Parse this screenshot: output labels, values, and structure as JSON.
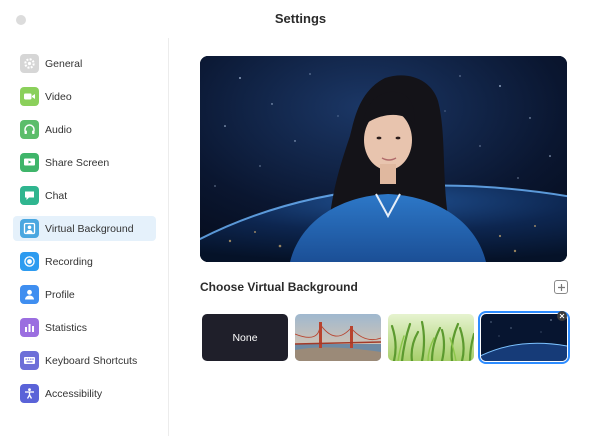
{
  "window": {
    "title": "Settings"
  },
  "sidebar": {
    "items": [
      {
        "label": "General",
        "icon": "gear-icon",
        "color": "#d6d6d6",
        "selected": false
      },
      {
        "label": "Video",
        "icon": "video-camera-icon",
        "color": "#8bd05b",
        "selected": false
      },
      {
        "label": "Audio",
        "icon": "headphones-icon",
        "color": "#5cbd6a",
        "selected": false
      },
      {
        "label": "Share Screen",
        "icon": "share-screen-icon",
        "color": "#3fb56a",
        "selected": false
      },
      {
        "label": "Chat",
        "icon": "chat-bubble-icon",
        "color": "#2fb58f",
        "selected": false
      },
      {
        "label": "Virtual Background",
        "icon": "portrait-icon",
        "color": "#4aa7e0",
        "selected": true
      },
      {
        "label": "Recording",
        "icon": "record-icon",
        "color": "#2d9bf0",
        "selected": false
      },
      {
        "label": "Profile",
        "icon": "person-icon",
        "color": "#3f8ef0",
        "selected": false
      },
      {
        "label": "Statistics",
        "icon": "bar-chart-icon",
        "color": "#9b6ee0",
        "selected": false
      },
      {
        "label": "Keyboard Shortcuts",
        "icon": "keyboard-icon",
        "color": "#6d6fd8",
        "selected": false
      },
      {
        "label": "Accessibility",
        "icon": "accessibility-icon",
        "color": "#5a63d8",
        "selected": false
      }
    ]
  },
  "main": {
    "section_title": "Choose Virtual Background",
    "add_icon": "plus-icon",
    "backgrounds": [
      {
        "label": "None",
        "kind": "none",
        "selected": false
      },
      {
        "label": "",
        "kind": "golden-gate-bridge",
        "selected": false
      },
      {
        "label": "",
        "kind": "grass",
        "selected": false
      },
      {
        "label": "",
        "kind": "earth-from-space",
        "selected": true
      }
    ],
    "remove_icon": "close-icon"
  },
  "colors": {
    "accent": "#2d8cff",
    "selected_row": "#e5f1fb"
  }
}
